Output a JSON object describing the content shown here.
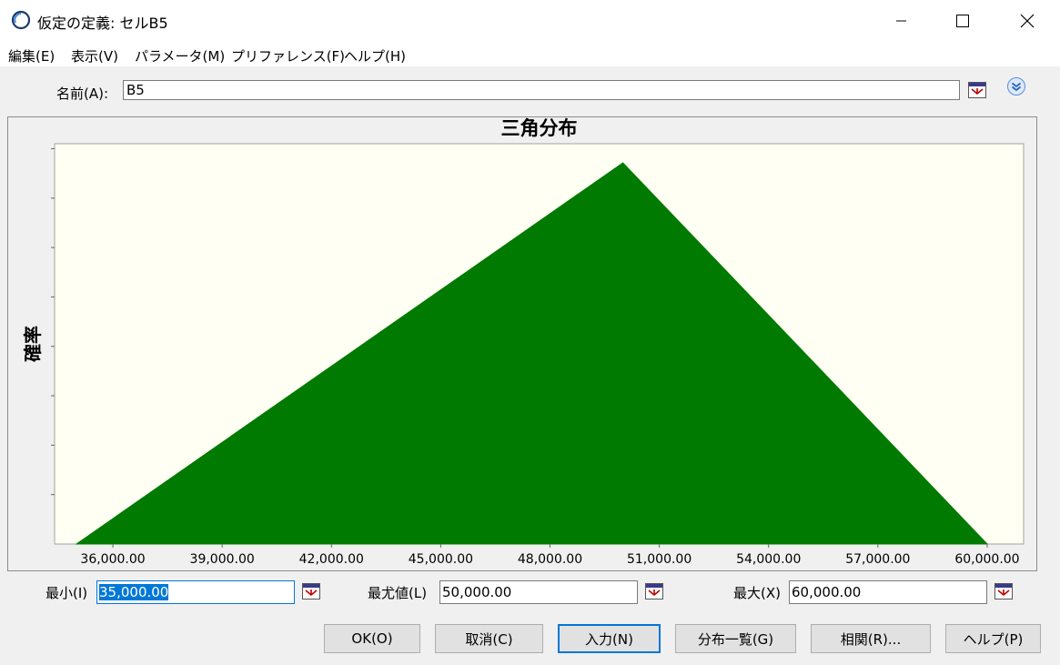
{
  "window": {
    "title": "仮定の定義: セルB5"
  },
  "menu": [
    "編集(E)",
    "表示(V)",
    "パラメータ(M)",
    "プリファレンス(F)",
    "ヘルプ(H)"
  ],
  "name_field": {
    "label": "名前(A):",
    "value": "B5"
  },
  "chart_data": {
    "type": "area",
    "title": "三角分布",
    "ylabel": "確率",
    "xlabel": "",
    "x_ticks": [
      "36,000.00",
      "39,000.00",
      "42,000.00",
      "45,000.00",
      "48,000.00",
      "51,000.00",
      "54,000.00",
      "57,000.00",
      "60,000.00"
    ],
    "x_tick_values": [
      36000,
      39000,
      42000,
      45000,
      48000,
      51000,
      54000,
      57000,
      60000
    ],
    "xlim": [
      34400,
      61000
    ],
    "series": [
      {
        "x": [
          35000,
          50000,
          60000
        ],
        "y": [
          0,
          1,
          0
        ]
      }
    ],
    "fill_color": "#007a00",
    "plot_background": "#fffff3",
    "grid": false,
    "y_tick_count": 8
  },
  "params": {
    "min": {
      "label": "最小(I)",
      "value": "35,000.00"
    },
    "likely": {
      "label": "最尤値(L)",
      "value": "50,000.00"
    },
    "max": {
      "label": "最大(X)",
      "value": "60,000.00"
    }
  },
  "buttons": {
    "ok": "OK(O)",
    "cancel": "取消(C)",
    "enter": "入力(N)",
    "gallery": "分布一覧(G)",
    "correlate": "相関(R)...",
    "help": "ヘルプ(P)"
  }
}
